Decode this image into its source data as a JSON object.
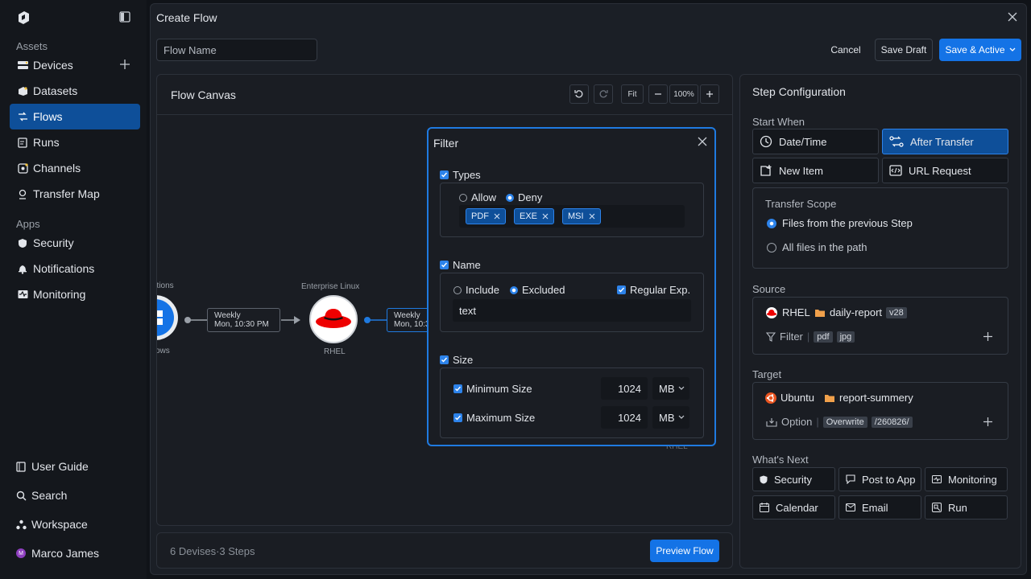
{
  "sidebar": {
    "assets_label": "Assets",
    "apps_label": "Apps",
    "items": [
      {
        "label": "Devices"
      },
      {
        "label": "Datasets"
      },
      {
        "label": "Flows"
      },
      {
        "label": "Runs"
      },
      {
        "label": "Channels"
      },
      {
        "label": "Transfer Map"
      }
    ],
    "apps": [
      {
        "label": "Security"
      },
      {
        "label": "Notifications"
      },
      {
        "label": "Monitoring"
      }
    ],
    "bottom": [
      {
        "label": "User Guide"
      },
      {
        "label": "Search"
      },
      {
        "label": "Workspace"
      },
      {
        "label": "Marco James"
      }
    ],
    "avatar_initial": "M"
  },
  "header": {
    "title": "Create Flow",
    "flow_name_placeholder": "Flow Name",
    "cancel": "Cancel",
    "save_draft": "Save Draft",
    "save_active": "Save & Active"
  },
  "canvas": {
    "title": "Flow Canvas",
    "fit": "Fit",
    "zoom": "100%",
    "node_left_top": "ations",
    "node_left_bottom": "ows",
    "edge1_line1": "Weekly",
    "edge1_line2": "Mon, 10:30 PM",
    "rhel_top": "Enterprise Linux",
    "rhel_bottom": "RHEL",
    "edge2_line1": "Weekly",
    "edge2_line2": "Mon, 10:3",
    "partial_label": "RHEL"
  },
  "filter": {
    "title": "Filter",
    "types_label": "Types",
    "allow": "Allow",
    "deny": "Deny",
    "chips": [
      "PDF",
      "EXE",
      "MSI"
    ],
    "name_label": "Name",
    "include": "Include",
    "excluded": "Excluded",
    "regex": "Regular Exp.",
    "name_value": "text",
    "size_label": "Size",
    "min_label": "Minimum Size",
    "min_value": "1024",
    "min_unit": "MB",
    "max_label": "Maximum Size",
    "max_value": "1024",
    "max_unit": "MB"
  },
  "footer": {
    "summary": "6 Devises·3 Steps",
    "preview": "Preview Flow"
  },
  "config": {
    "title": "Step Configuration",
    "start_when": "Start When",
    "options": [
      "Date/Time",
      "After Transfer",
      "New Item",
      "URL Request"
    ],
    "scope_label": "Transfer Scope",
    "scope_options": [
      "Files from the previous Step",
      "All files in the path"
    ],
    "source_label": "Source",
    "source_device": "RHEL",
    "source_folder": "daily-report",
    "source_version": "v28",
    "filter_label": "Filter",
    "filter_tags": [
      "pdf",
      "jpg"
    ],
    "target_label": "Target",
    "target_device": "Ubuntu",
    "target_folder": "report-summery",
    "option_label": "Option",
    "option_tags": [
      "Overwrite",
      "/260826/"
    ],
    "next_label": "What's Next",
    "next_items": [
      "Security",
      "Post to App",
      "Monitoring",
      "Calendar",
      "Email",
      "Run"
    ]
  },
  "colors": {
    "accent": "#1473e6",
    "active_nav": "#0e4f99",
    "rhel_red": "#e00",
    "folder": "#f0a04b",
    "ubuntu": "#e95420"
  }
}
